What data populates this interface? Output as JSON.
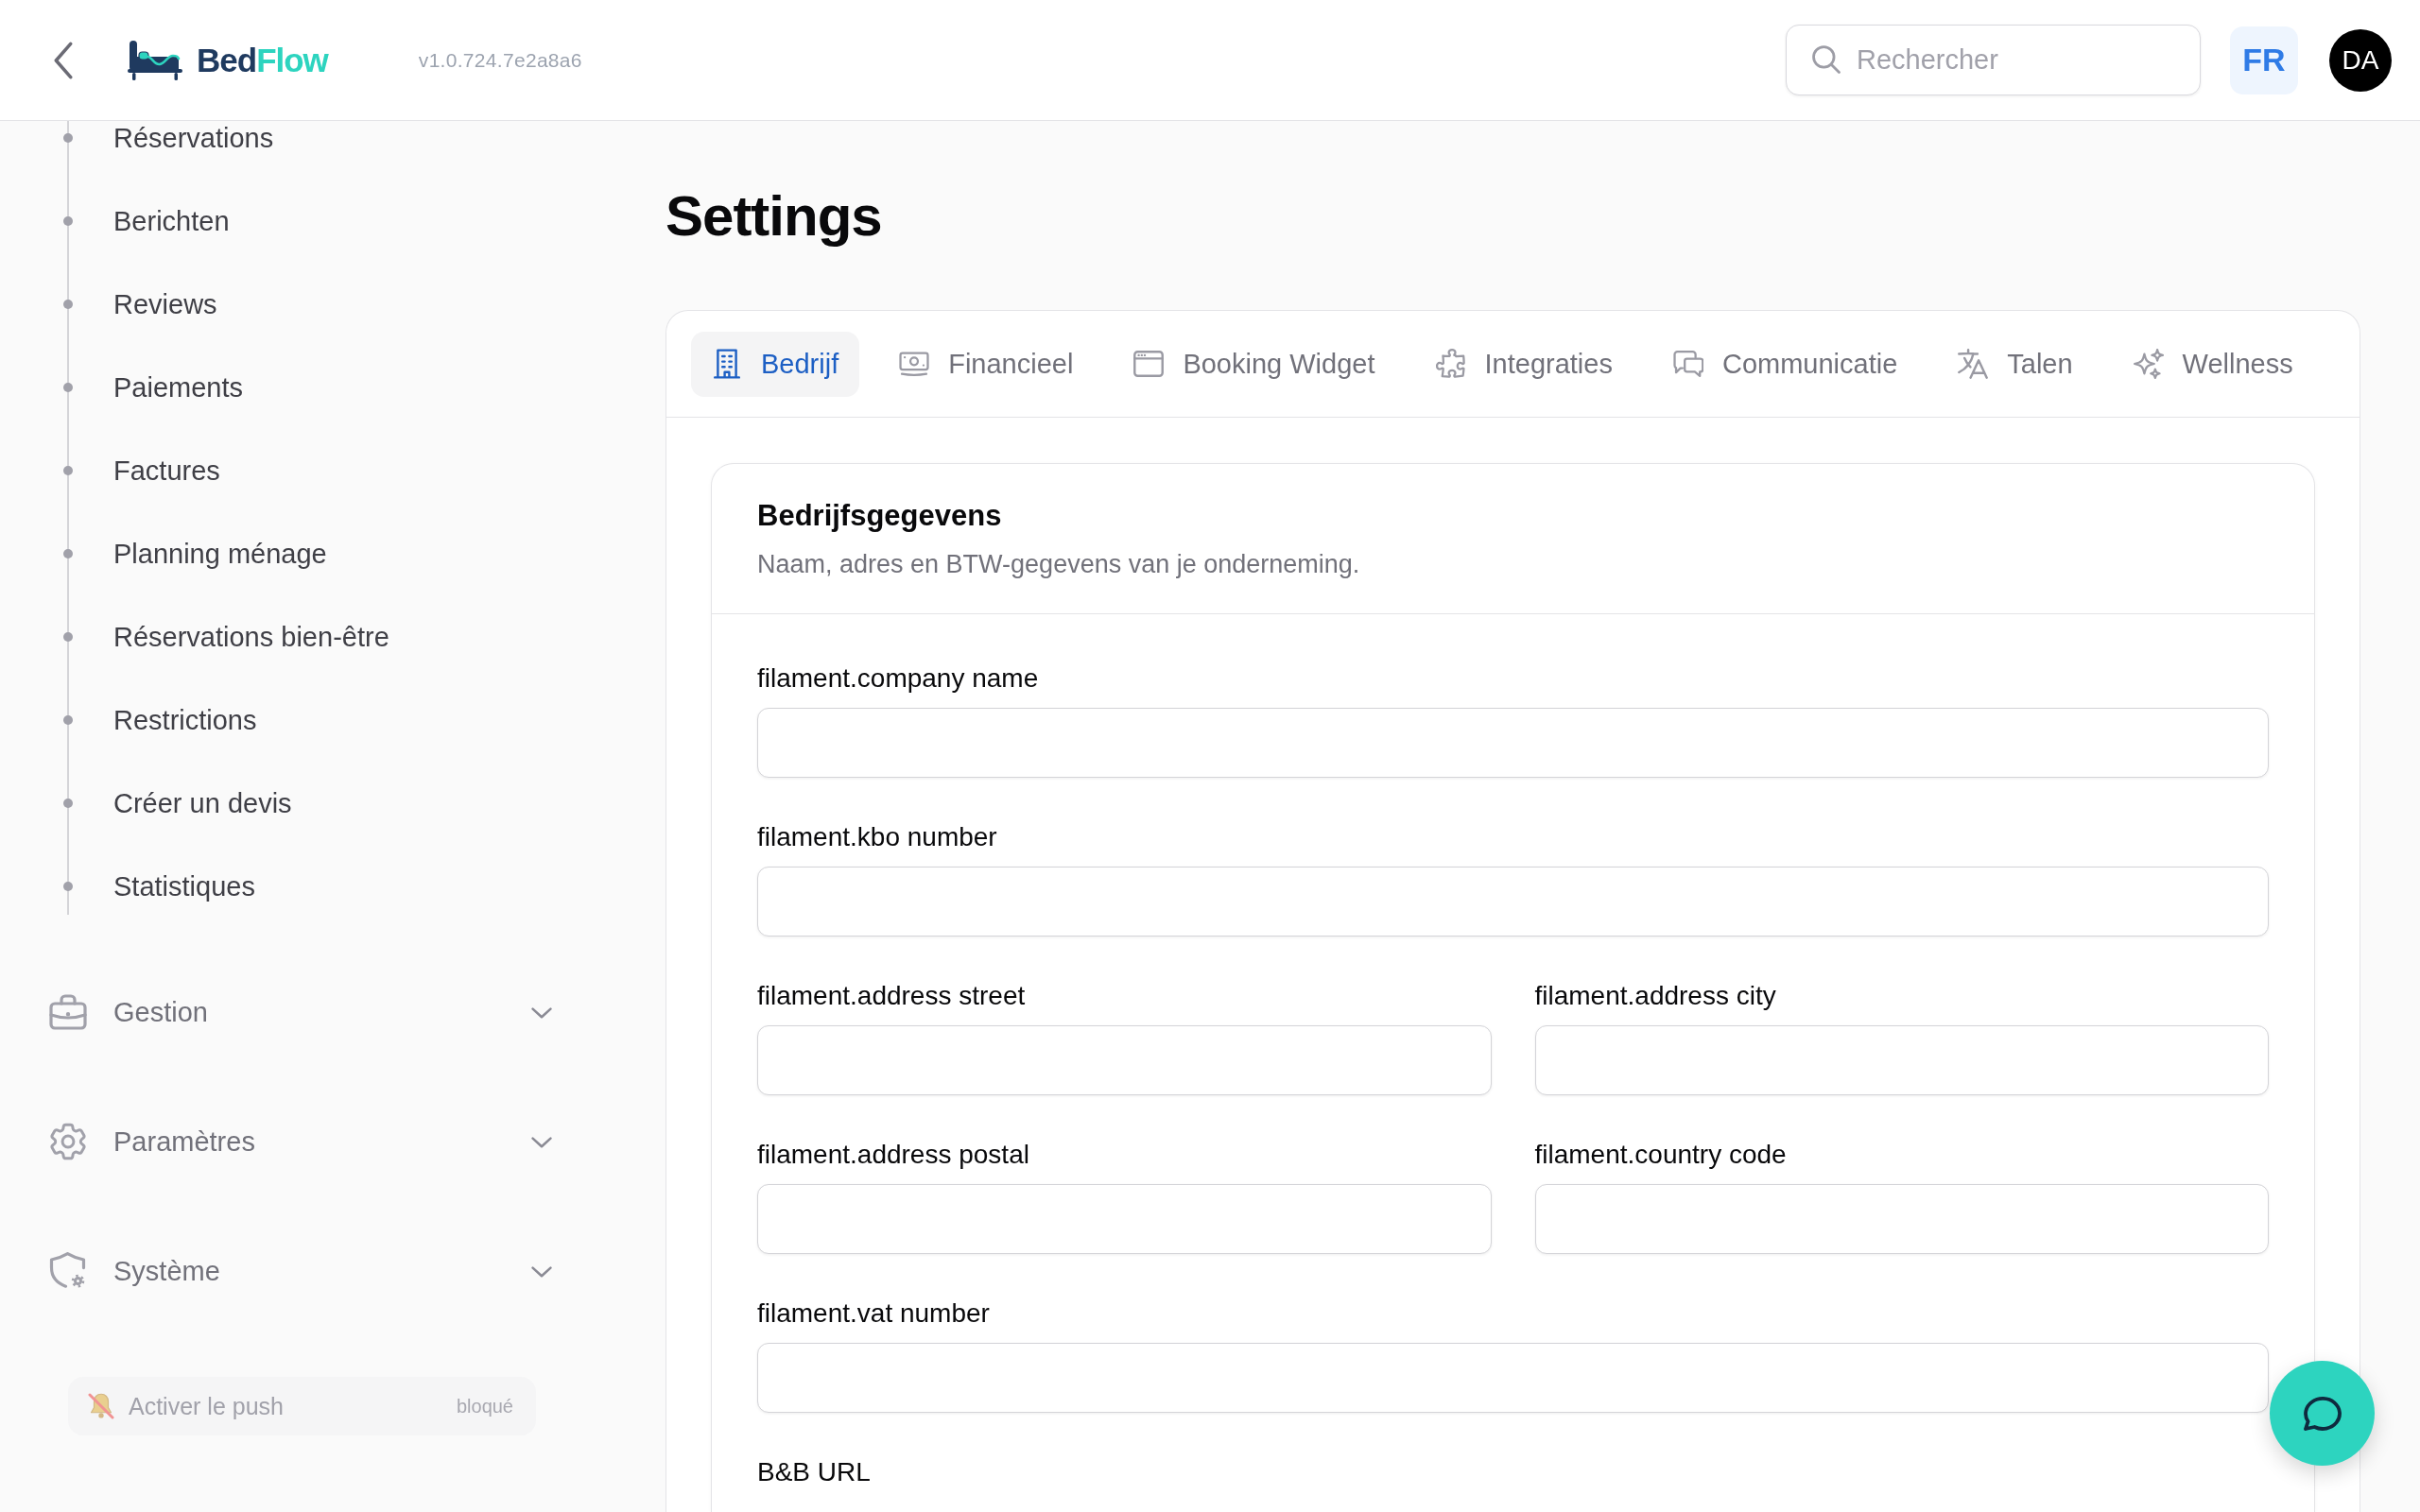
{
  "header": {
    "brand": {
      "part_1": "Bed",
      "part_2": "Flow"
    },
    "version": "v1.0.724.7e2a8a6",
    "search": {
      "placeholder": "Rechercher"
    },
    "language": "FR",
    "avatar": "DA"
  },
  "sidebar": {
    "items": [
      {
        "label": "Réservations",
        "selected": false
      },
      {
        "label": "Berichten",
        "selected": false
      },
      {
        "label": "Reviews",
        "selected": false
      },
      {
        "label": "Paiements",
        "selected": false
      },
      {
        "label": "Factures",
        "selected": false
      },
      {
        "label": "Planning ménage",
        "selected": false
      },
      {
        "label": "Réservations bien-être",
        "selected": false
      },
      {
        "label": "Restrictions",
        "selected": false
      },
      {
        "label": "Créer un devis",
        "selected": false
      },
      {
        "label": "Statistiques",
        "selected": false
      }
    ],
    "groups": [
      {
        "label": "Gestion",
        "expanded": false
      },
      {
        "label": "Paramètres",
        "expanded": false
      },
      {
        "label": "Système",
        "expanded": false
      }
    ],
    "push": {
      "label": "Activer le push",
      "status": "bloqué",
      "disabled": true
    }
  },
  "page": {
    "title": "Settings"
  },
  "tabs": [
    {
      "label": "Bedrijf",
      "selected": true
    },
    {
      "label": "Financieel",
      "selected": false
    },
    {
      "label": "Booking Widget",
      "selected": false
    },
    {
      "label": "Integraties",
      "selected": false
    },
    {
      "label": "Communicatie",
      "selected": false
    },
    {
      "label": "Talen",
      "selected": false
    },
    {
      "label": "Wellness",
      "selected": false
    }
  ],
  "section": {
    "title": "Bedrijfsgegevens",
    "description": "Naam, adres en BTW-gegevens van je onderneming.",
    "rows": [
      [
        {
          "label": "filament.company name",
          "kind": "text_input"
        }
      ],
      [
        {
          "label": "filament.kbo number",
          "kind": "text_input"
        }
      ],
      [
        {
          "label": "filament.address street",
          "kind": "text_input"
        },
        {
          "label": "filament.address city",
          "kind": "text_input"
        }
      ],
      [
        {
          "label": "filament.address postal",
          "kind": "text_input"
        },
        {
          "label": "filament.country code",
          "kind": "text_input"
        }
      ],
      [
        {
          "label": "filament.vat number",
          "kind": "text_input"
        }
      ],
      [
        {
          "label": "B&B URL",
          "kind": "label_only"
        }
      ]
    ]
  }
}
